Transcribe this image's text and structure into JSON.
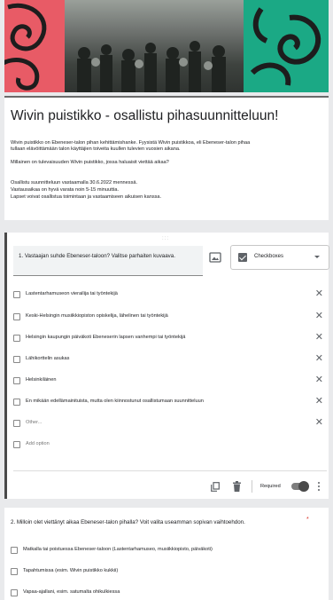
{
  "form": {
    "title": "Wivin puistikko - osallistu pihasuunnitteluun!",
    "description": [
      "Wivin puistikko on Ebeneser-talon pihan kehittämishanke. Fyysistä Wivin puistikkoa, eli Ebeneser-talon pihaa",
      "tullaan elävöittämään talon käyttäjien toiveita kuullen tulevien vuosien aikana.",
      "",
      "Millainen on tulevaisuuden Wivin puistikko, jossa haluaisit viettää aikaa?",
      "",
      "Osallistu suunnitteluun vastaamalla 30.6.2022 mennessä.",
      "Vastausaikaa on hyvä varata noin 5-15 minuuttia.",
      "Lapset voivat osallistua toimintaan ja vastaamiseen aikuisen kanssa."
    ]
  },
  "question1": {
    "title": "1. Vastaajan suhde Ebeneser-taloon? Valitse parhaiten kuvaava.",
    "type_label": "Checkboxes",
    "drag_handle": ":::",
    "options": [
      "Lastentarhamuseon vierailija tai työntekijä",
      "Keski-Helsingin musiikkiopiston opiskelija, lähelinen tai työntekijä",
      "Helsingin kaupungin päiväkoti Ebeneserin lapsen vanhempi tai työntekijä",
      "Lähikorttelin asukas",
      "Helsinkiläinen",
      "En mikään edellämainituista, mutta olen kiinnostunut osallistumaan suunnitteluun"
    ],
    "other_label": "Other...",
    "add_option_label": "Add option",
    "required_label": "Required",
    "required": true,
    "remove_glyph": "✕"
  },
  "question2": {
    "title": "2. Milloin olet viettänyt aikaa Ebeneser-talon pihalla? Voit valita useamman sopivan vaihtoehdon.",
    "required_mark": "*",
    "options": [
      "Matkalla tai poistuessa Ebeneser-taloon  (Lastentarhamuseo, musiikkiopisto, päiväkoti)",
      "Tapahtumissa (esim. Wivin puistikko kukkii)",
      "Vapaa-ajallani, esim. satumalta ohikulkiessa"
    ]
  },
  "colors": {
    "banner_pink": "#e85b66",
    "banner_green": "#1ba985",
    "toggle_on": "#4a4a4a",
    "required_star": "#d93025"
  },
  "icons": [
    "image-icon",
    "checkbox-type-icon",
    "dropdown-caret-icon",
    "close-icon",
    "duplicate-icon",
    "delete-icon",
    "more-vert-icon"
  ]
}
